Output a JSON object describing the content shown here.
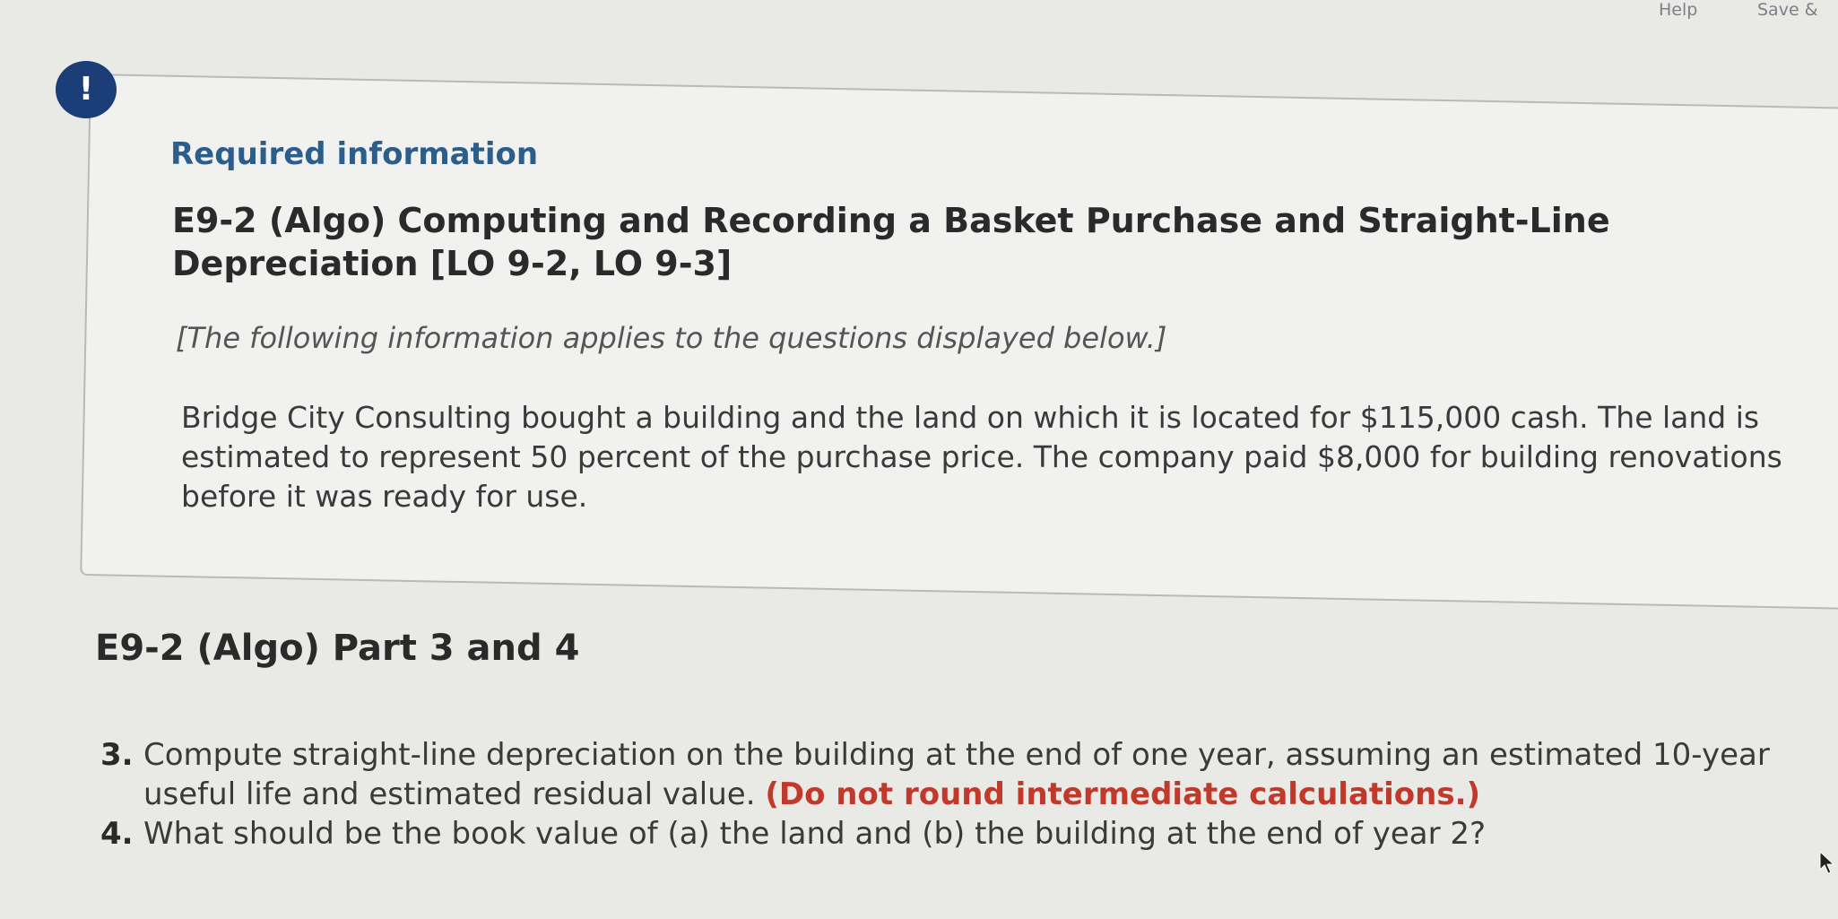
{
  "toolbar": {
    "help_label": "Help",
    "save_label": "Save &"
  },
  "alert": {
    "symbol": "!",
    "color": "#1c3e78"
  },
  "info_card": {
    "title": "Required information",
    "problem_heading": "E9-2 (Algo) Computing and Recording a Basket Purchase and Straight-Line Depreciation [LO 9-2, LO 9-3]",
    "applies_note": "[The following information applies to the questions displayed below.]",
    "scenario": "Bridge City Consulting bought a building and the land on which it is located for $115,000 cash. The land is estimated to represent 50 percent of the purchase price. The company paid $8,000 for building renovations before it was ready for use."
  },
  "part": {
    "heading": "E9-2 (Algo) Part 3 and 4"
  },
  "questions": [
    {
      "number": "3.",
      "text": "Compute straight-line depreciation on the building at the end of one year, assuming an estimated 10-year useful life and estimated residual value. ",
      "note": "(Do not round intermediate calculations.)"
    },
    {
      "number": "4.",
      "text": "What should be the book value of (a) the land and (b) the building at the end of year 2?"
    }
  ],
  "colors": {
    "title_blue": "#2c5e8c",
    "note_red": "#c0392b"
  }
}
